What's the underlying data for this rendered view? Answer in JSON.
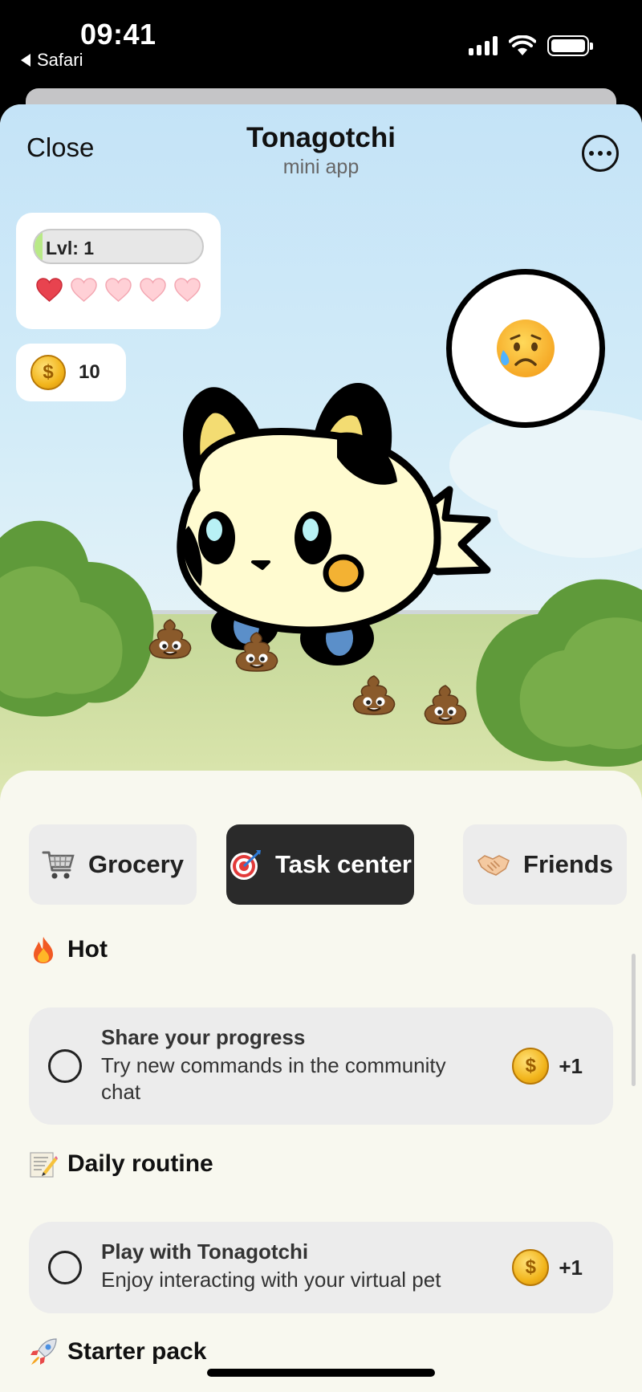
{
  "status_bar": {
    "time": "09:41",
    "back_label": "Safari"
  },
  "header": {
    "close_label": "Close",
    "title": "Tonagotchi",
    "subtitle": "mini app"
  },
  "stats": {
    "level_label": "Lvl: 1",
    "level_progress": 0.05,
    "hearts_total": 5,
    "hearts_filled": 1,
    "coins": "10"
  },
  "mood": {
    "emoji_name": "sad-sweat-face-icon"
  },
  "tabs": [
    {
      "label": "Grocery",
      "icon": "shopping-cart-icon"
    },
    {
      "label": "Task center",
      "icon": "dart-target-icon",
      "active": true
    },
    {
      "label": "Friends",
      "icon": "handshake-icon"
    }
  ],
  "sections": {
    "hot": {
      "title": "Hot",
      "icon": "fire-icon",
      "tasks": [
        {
          "title": "Share your progress",
          "description": "Try new commands in the community chat",
          "reward": "+1"
        }
      ]
    },
    "daily": {
      "title": "Daily routine",
      "icon": "memo-icon",
      "tasks": [
        {
          "title": "Play with Tonagotchi",
          "description": "Enjoy interacting with your virtual pet",
          "reward": "+1"
        }
      ]
    },
    "starter": {
      "title": "Starter pack",
      "icon": "rocket-icon"
    }
  },
  "colors": {
    "sky": "#c4e3f7",
    "grass": "#c5d899",
    "bush": "#5f9a3a",
    "panel": "#f8f8ef",
    "active_tab": "#2a2a2a",
    "heart_filled": "#e8434f",
    "heart_empty": "#ffd0d6",
    "level_fill": "#b8e986"
  }
}
